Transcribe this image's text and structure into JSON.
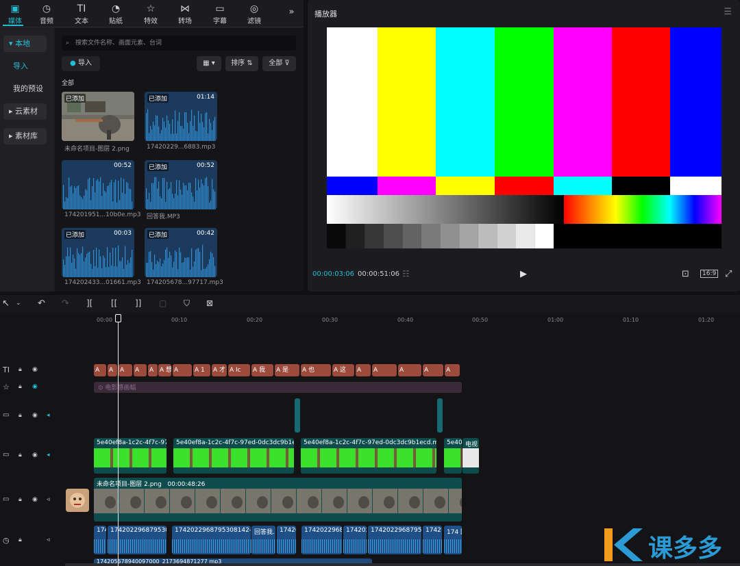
{
  "toolbar": {
    "tabs": [
      {
        "label": "媒体",
        "icon": "media-icon"
      },
      {
        "label": "音频",
        "icon": "audio-icon"
      },
      {
        "label": "文本",
        "icon": "text-icon"
      },
      {
        "label": "贴纸",
        "icon": "sticker-icon"
      },
      {
        "label": "特效",
        "icon": "effects-icon"
      },
      {
        "label": "转场",
        "icon": "transition-icon"
      },
      {
        "label": "字幕",
        "icon": "subtitle-icon"
      },
      {
        "label": "滤镜",
        "icon": "filter-icon"
      }
    ],
    "more": "»"
  },
  "sidebar": {
    "local": "▾ 本地",
    "import": "导入",
    "presets": "我的预设",
    "cloud": "▸ 云素材",
    "library": "▸ 素材库"
  },
  "media": {
    "search_placeholder": "搜索文件名称、画面元素、台词",
    "import_btn": "导入",
    "sort": "排序",
    "filter": "全部",
    "section": "全部",
    "items": [
      {
        "tag": "已添加",
        "duration": "",
        "name": "未命名项目-图层 2.png"
      },
      {
        "tag": "已添加",
        "duration": "01:14",
        "name": "17420229...6883.mp3"
      },
      {
        "tag": "",
        "duration": "00:52",
        "name": "174201951...10b0e.mp3"
      },
      {
        "tag": "已添加",
        "duration": "00:52",
        "name": "回答我.MP3"
      },
      {
        "tag": "已添加",
        "duration": "00:03",
        "name": "174202433...01661.mp3"
      },
      {
        "tag": "已添加",
        "duration": "00:42",
        "name": "174205678...97717.mp3"
      }
    ]
  },
  "player": {
    "title": "播放器",
    "current": "00:00:03:06",
    "total": "00:00:51:06",
    "ratio": "16:9",
    "colors": {
      "accent": "#21c0d6"
    }
  },
  "ruler": [
    "00:00",
    "00:10",
    "00:20",
    "00:30",
    "00:40",
    "00:50",
    "01:00",
    "01:10",
    "01:20"
  ],
  "timeline": {
    "text_chips": [
      "A",
      "A",
      "A",
      "A",
      "A",
      "A 想",
      "A",
      "A 1",
      "A 才",
      "A Ic",
      "A 我",
      "A 是",
      "A 也",
      "A 这",
      "A",
      "A",
      "A",
      "A",
      "A"
    ],
    "effect_label": "电影感画幅",
    "video_clips": [
      "5e40ef8a-1c2c-4f7c-97",
      "5e40ef8a-1c2c-4f7c-97ed-0dc3dc9b1e",
      "5e40ef8a-1c2c-4f7c-97ed-0dc3dc9b1ecd.mp",
      "5e40",
      "电视"
    ],
    "main_clip": {
      "name": "未命名项目-图层 2.png",
      "duration": "00:00:48:26"
    },
    "audio_clips": [
      "174",
      "174202296879530",
      "1742022968795308142-2",
      "回答我.",
      "17420",
      "17420229687",
      "174202",
      "1742022968795 30",
      "1742",
      "174 回"
    ],
    "bottom_clip": "174205678940097000_2173694871277 mp3"
  },
  "watermark": "课多多"
}
